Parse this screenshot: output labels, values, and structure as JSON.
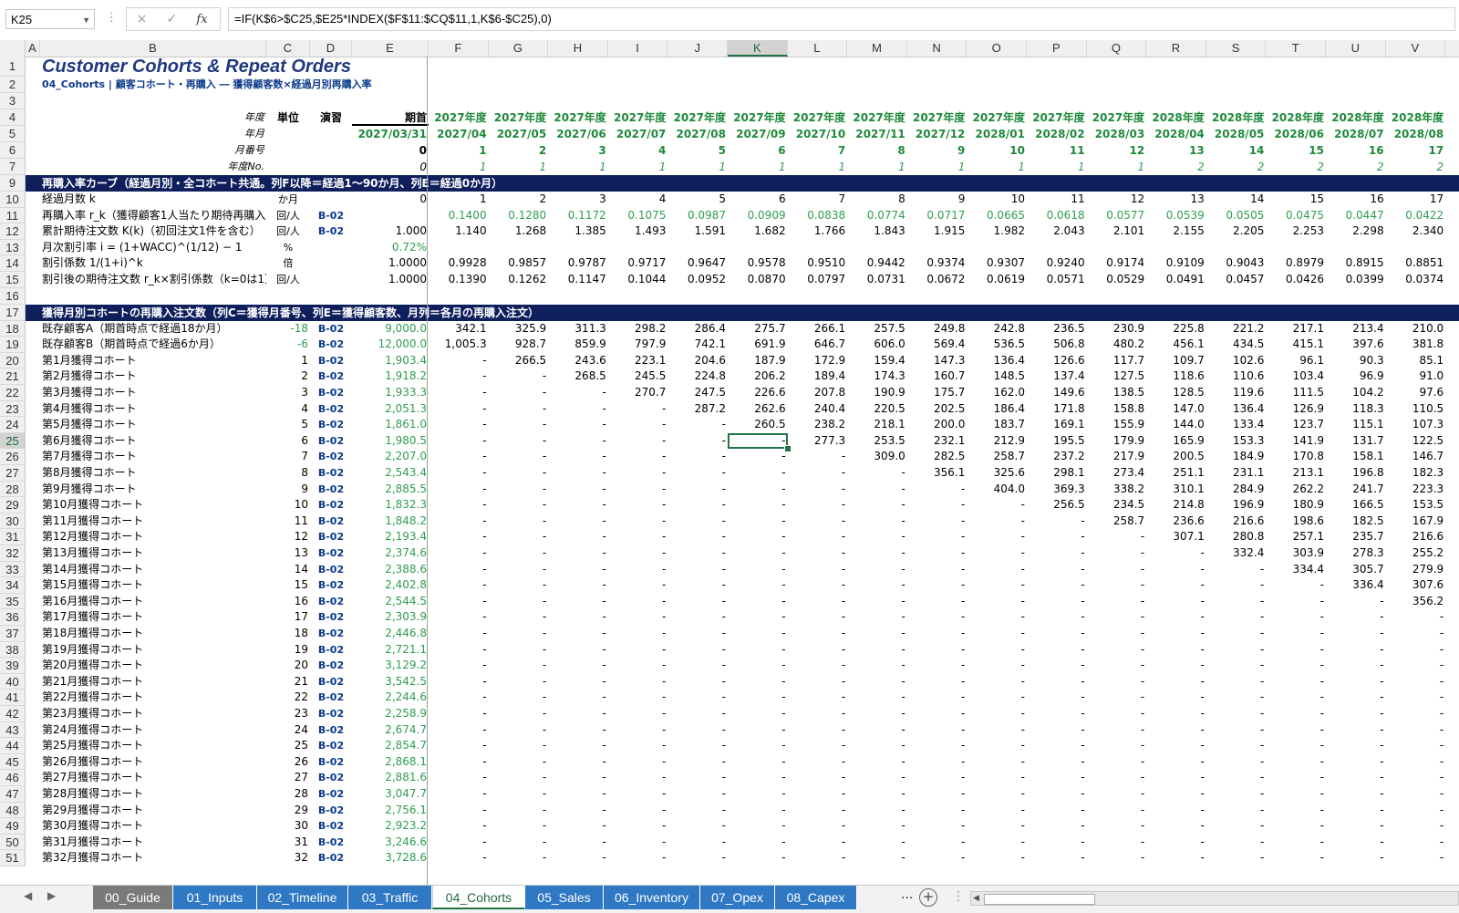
{
  "namebox": "K25",
  "formula": "=IF(K$6>$C25,$E25*INDEX($F$11:$CQ$11,1,K$6-$C25),0)",
  "formula_icons": {
    "cancel": "×",
    "enter": "✓",
    "fx": "fx"
  },
  "columns": [
    "A",
    "B",
    "C",
    "D",
    "E",
    "F",
    "G",
    "H",
    "I",
    "J",
    "K",
    "L",
    "M",
    "N",
    "O",
    "P",
    "Q",
    "R",
    "S",
    "T",
    "U",
    "V"
  ],
  "selected_column": "K",
  "selected_row": "25",
  "rows_numbers": [
    "1",
    "2",
    "3",
    "4",
    "5",
    "6",
    "7",
    "9",
    "10",
    "11",
    "12",
    "13",
    "14",
    "15",
    "16",
    "17",
    "18",
    "19",
    "20",
    "21",
    "22",
    "23",
    "24",
    "25",
    "26",
    "27",
    "28",
    "29",
    "30",
    "31",
    "32",
    "33",
    "34",
    "35",
    "36",
    "37",
    "38",
    "39",
    "40",
    "41",
    "42",
    "43",
    "44",
    "45",
    "46",
    "47",
    "48",
    "49",
    "50",
    "51"
  ],
  "title": "Customer Cohorts & Repeat Orders",
  "subtitle": "04_Cohorts | 顧客コホート・再購入 ― 獲得顧客数×経過月別再購入率",
  "header": {
    "row4": {
      "label": "年度",
      "unit": "単位",
      "ref": "演習",
      "e": "期首",
      "vals": [
        "2027年度",
        "2027年度",
        "2027年度",
        "2027年度",
        "2027年度",
        "2027年度",
        "2027年度",
        "2027年度",
        "2027年度",
        "2027年度",
        "2027年度",
        "2027年度",
        "2028年度",
        "2028年度",
        "2028年度",
        "2028年度",
        "2028年度"
      ]
    },
    "row5": {
      "label": "年月",
      "e": "2027/03/31",
      "vals": [
        "2027/04",
        "2027/05",
        "2027/06",
        "2027/07",
        "2027/08",
        "2027/09",
        "2027/10",
        "2027/11",
        "2027/12",
        "2028/01",
        "2028/02",
        "2028/03",
        "2028/04",
        "2028/05",
        "2028/06",
        "2028/07",
        "2028/08"
      ]
    },
    "row6": {
      "label": "月番号",
      "e": "0",
      "vals": [
        "1",
        "2",
        "3",
        "4",
        "5",
        "6",
        "7",
        "8",
        "9",
        "10",
        "11",
        "12",
        "13",
        "14",
        "15",
        "16",
        "17"
      ]
    },
    "row7": {
      "label": "年度No.",
      "e": "0",
      "vals": [
        "1",
        "1",
        "1",
        "1",
        "1",
        "1",
        "1",
        "1",
        "1",
        "1",
        "1",
        "1",
        "2",
        "2",
        "2",
        "2",
        "2"
      ]
    }
  },
  "section1": "再購入率カーブ（経過月別・全コホート共通。列F以降＝経過1～90か月、列E＝経過0か月）",
  "curve": [
    {
      "label": "経過月数 k",
      "unit": "か月",
      "ref": "",
      "e": "0",
      "cls": "",
      "vals": [
        "1",
        "2",
        "3",
        "4",
        "5",
        "6",
        "7",
        "8",
        "9",
        "10",
        "11",
        "12",
        "13",
        "14",
        "15",
        "16",
        "17"
      ]
    },
    {
      "label": "再購入率 r_k（獲得顧客1人当たり期待再購入注文数）",
      "unit": "回/人",
      "ref": "B-02",
      "e": "",
      "cls": "green",
      "vals": [
        "0.1400",
        "0.1280",
        "0.1172",
        "0.1075",
        "0.0987",
        "0.0909",
        "0.0838",
        "0.0774",
        "0.0717",
        "0.0665",
        "0.0618",
        "0.0577",
        "0.0539",
        "0.0505",
        "0.0475",
        "0.0447",
        "0.0422"
      ]
    },
    {
      "label": "累計期待注文数 K(k)（初回注文1件を含む）",
      "unit": "回/人",
      "ref": "B-02",
      "e": "1.000",
      "cls": "",
      "vals": [
        "1.140",
        "1.268",
        "1.385",
        "1.493",
        "1.591",
        "1.682",
        "1.766",
        "1.843",
        "1.915",
        "1.982",
        "2.043",
        "2.101",
        "2.155",
        "2.205",
        "2.253",
        "2.298",
        "2.340"
      ]
    },
    {
      "label": "月次割引率 i = (1+WACC)^(1/12) − 1",
      "unit": "%",
      "ref": "",
      "e": "0.72%",
      "cls": "green-e",
      "vals": []
    },
    {
      "label": "割引係数 1/(1+i)^k",
      "unit": "倍",
      "ref": "",
      "e": "1.0000",
      "cls": "",
      "vals": [
        "0.9928",
        "0.9857",
        "0.9787",
        "0.9717",
        "0.9647",
        "0.9578",
        "0.9510",
        "0.9442",
        "0.9374",
        "0.9307",
        "0.9240",
        "0.9174",
        "0.9109",
        "0.9043",
        "0.8979",
        "0.8915",
        "0.8851"
      ]
    },
    {
      "label": "割引後の期待注文数 r_k×割引係数（k=0は1）",
      "unit": "回/人",
      "ref": "",
      "e": "1.0000",
      "cls": "",
      "vals": [
        "0.1390",
        "0.1262",
        "0.1147",
        "0.1044",
        "0.0952",
        "0.0870",
        "0.0797",
        "0.0731",
        "0.0672",
        "0.0619",
        "0.0571",
        "0.0529",
        "0.0491",
        "0.0457",
        "0.0426",
        "0.0399",
        "0.0374"
      ]
    }
  ],
  "section2": "獲得月別コホートの再購入注文数（列C＝獲得月番号、列E＝獲得顧客数、月列＝各月の再購入注文）",
  "cohorts": [
    {
      "label": "既存顧客A（期首時点で経過18か月）",
      "c": "-18",
      "ref": "B-02",
      "e": "9,000.0",
      "vals": [
        "342.1",
        "325.9",
        "311.3",
        "298.2",
        "286.4",
        "275.7",
        "266.1",
        "257.5",
        "249.8",
        "242.8",
        "236.5",
        "230.9",
        "225.8",
        "221.2",
        "217.1",
        "213.4",
        "210.0"
      ]
    },
    {
      "label": "既存顧客B（期首時点で経過6か月）",
      "c": "-6",
      "ref": "B-02",
      "e": "12,000.0",
      "vals": [
        "1,005.3",
        "928.7",
        "859.9",
        "797.9",
        "742.1",
        "691.9",
        "646.7",
        "606.0",
        "569.4",
        "536.5",
        "506.8",
        "480.2",
        "456.1",
        "434.5",
        "415.1",
        "397.6",
        "381.8"
      ]
    },
    {
      "label": "第1月獲得コホート",
      "c": "1",
      "ref": "B-02",
      "e": "1,903.4",
      "vals": [
        "-",
        "266.5",
        "243.6",
        "223.1",
        "204.6",
        "187.9",
        "172.9",
        "159.4",
        "147.3",
        "136.4",
        "126.6",
        "117.7",
        "109.7",
        "102.6",
        "96.1",
        "90.3",
        "85.1"
      ]
    },
    {
      "label": "第2月獲得コホート",
      "c": "2",
      "ref": "B-02",
      "e": "1,918.2",
      "vals": [
        "-",
        "-",
        "268.5",
        "245.5",
        "224.8",
        "206.2",
        "189.4",
        "174.3",
        "160.7",
        "148.5",
        "137.4",
        "127.5",
        "118.6",
        "110.6",
        "103.4",
        "96.9",
        "91.0"
      ]
    },
    {
      "label": "第3月獲得コホート",
      "c": "3",
      "ref": "B-02",
      "e": "1,933.3",
      "vals": [
        "-",
        "-",
        "-",
        "270.7",
        "247.5",
        "226.6",
        "207.8",
        "190.9",
        "175.7",
        "162.0",
        "149.6",
        "138.5",
        "128.5",
        "119.6",
        "111.5",
        "104.2",
        "97.6"
      ]
    },
    {
      "label": "第4月獲得コホート",
      "c": "4",
      "ref": "B-02",
      "e": "2,051.3",
      "vals": [
        "-",
        "-",
        "-",
        "-",
        "287.2",
        "262.6",
        "240.4",
        "220.5",
        "202.5",
        "186.4",
        "171.8",
        "158.8",
        "147.0",
        "136.4",
        "126.9",
        "118.3",
        "110.5"
      ]
    },
    {
      "label": "第5月獲得コホート",
      "c": "5",
      "ref": "B-02",
      "e": "1,861.0",
      "vals": [
        "-",
        "-",
        "-",
        "-",
        "-",
        "260.5",
        "238.2",
        "218.1",
        "200.0",
        "183.7",
        "169.1",
        "155.9",
        "144.0",
        "133.4",
        "123.7",
        "115.1",
        "107.3"
      ]
    },
    {
      "label": "第6月獲得コホート",
      "c": "6",
      "ref": "B-02",
      "e": "1,980.5",
      "vals": [
        "-",
        "-",
        "-",
        "-",
        "-",
        "-",
        "277.3",
        "253.5",
        "232.1",
        "212.9",
        "195.5",
        "179.9",
        "165.9",
        "153.3",
        "141.9",
        "131.7",
        "122.5"
      ]
    },
    {
      "label": "第7月獲得コホート",
      "c": "7",
      "ref": "B-02",
      "e": "2,207.0",
      "vals": [
        "-",
        "-",
        "-",
        "-",
        "-",
        "-",
        "-",
        "309.0",
        "282.5",
        "258.7",
        "237.2",
        "217.9",
        "200.5",
        "184.9",
        "170.8",
        "158.1",
        "146.7"
      ]
    },
    {
      "label": "第8月獲得コホート",
      "c": "8",
      "ref": "B-02",
      "e": "2,543.4",
      "vals": [
        "-",
        "-",
        "-",
        "-",
        "-",
        "-",
        "-",
        "-",
        "356.1",
        "325.6",
        "298.1",
        "273.4",
        "251.1",
        "231.1",
        "213.1",
        "196.8",
        "182.3"
      ]
    },
    {
      "label": "第9月獲得コホート",
      "c": "9",
      "ref": "B-02",
      "e": "2,885.5",
      "vals": [
        "-",
        "-",
        "-",
        "-",
        "-",
        "-",
        "-",
        "-",
        "-",
        "404.0",
        "369.3",
        "338.2",
        "310.1",
        "284.9",
        "262.2",
        "241.7",
        "223.3"
      ]
    },
    {
      "label": "第10月獲得コホート",
      "c": "10",
      "ref": "B-02",
      "e": "1,832.3",
      "vals": [
        "-",
        "-",
        "-",
        "-",
        "-",
        "-",
        "-",
        "-",
        "-",
        "-",
        "256.5",
        "234.5",
        "214.8",
        "196.9",
        "180.9",
        "166.5",
        "153.5"
      ]
    },
    {
      "label": "第11月獲得コホート",
      "c": "11",
      "ref": "B-02",
      "e": "1,848.2",
      "vals": [
        "-",
        "-",
        "-",
        "-",
        "-",
        "-",
        "-",
        "-",
        "-",
        "-",
        "-",
        "258.7",
        "236.6",
        "216.6",
        "198.6",
        "182.5",
        "167.9"
      ]
    },
    {
      "label": "第12月獲得コホート",
      "c": "12",
      "ref": "B-02",
      "e": "2,193.4",
      "vals": [
        "-",
        "-",
        "-",
        "-",
        "-",
        "-",
        "-",
        "-",
        "-",
        "-",
        "-",
        "-",
        "307.1",
        "280.8",
        "257.1",
        "235.7",
        "216.6"
      ]
    },
    {
      "label": "第13月獲得コホート",
      "c": "13",
      "ref": "B-02",
      "e": "2,374.6",
      "vals": [
        "-",
        "-",
        "-",
        "-",
        "-",
        "-",
        "-",
        "-",
        "-",
        "-",
        "-",
        "-",
        "-",
        "332.4",
        "303.9",
        "278.3",
        "255.2"
      ]
    },
    {
      "label": "第14月獲得コホート",
      "c": "14",
      "ref": "B-02",
      "e": "2,388.6",
      "vals": [
        "-",
        "-",
        "-",
        "-",
        "-",
        "-",
        "-",
        "-",
        "-",
        "-",
        "-",
        "-",
        "-",
        "-",
        "334.4",
        "305.7",
        "279.9"
      ]
    },
    {
      "label": "第15月獲得コホート",
      "c": "15",
      "ref": "B-02",
      "e": "2,402.8",
      "vals": [
        "-",
        "-",
        "-",
        "-",
        "-",
        "-",
        "-",
        "-",
        "-",
        "-",
        "-",
        "-",
        "-",
        "-",
        "-",
        "336.4",
        "307.6"
      ]
    },
    {
      "label": "第16月獲得コホート",
      "c": "16",
      "ref": "B-02",
      "e": "2,544.5",
      "vals": [
        "-",
        "-",
        "-",
        "-",
        "-",
        "-",
        "-",
        "-",
        "-",
        "-",
        "-",
        "-",
        "-",
        "-",
        "-",
        "-",
        "356.2"
      ]
    },
    {
      "label": "第17月獲得コホート",
      "c": "17",
      "ref": "B-02",
      "e": "2,303.9",
      "vals": []
    },
    {
      "label": "第18月獲得コホート",
      "c": "18",
      "ref": "B-02",
      "e": "2,446.8",
      "vals": []
    },
    {
      "label": "第19月獲得コホート",
      "c": "19",
      "ref": "B-02",
      "e": "2,721.1",
      "vals": []
    },
    {
      "label": "第20月獲得コホート",
      "c": "20",
      "ref": "B-02",
      "e": "3,129.2",
      "vals": []
    },
    {
      "label": "第21月獲得コホート",
      "c": "21",
      "ref": "B-02",
      "e": "3,542.5",
      "vals": []
    },
    {
      "label": "第22月獲得コホート",
      "c": "22",
      "ref": "B-02",
      "e": "2,244.6",
      "vals": []
    },
    {
      "label": "第23月獲得コホート",
      "c": "23",
      "ref": "B-02",
      "e": "2,258.9",
      "vals": []
    },
    {
      "label": "第24月獲得コホート",
      "c": "24",
      "ref": "B-02",
      "e": "2,674.7",
      "vals": []
    },
    {
      "label": "第25月獲得コホート",
      "c": "25",
      "ref": "B-02",
      "e": "2,854.7",
      "vals": []
    },
    {
      "label": "第26月獲得コホート",
      "c": "26",
      "ref": "B-02",
      "e": "2,868.1",
      "vals": []
    },
    {
      "label": "第27月獲得コホート",
      "c": "27",
      "ref": "B-02",
      "e": "2,881.6",
      "vals": []
    },
    {
      "label": "第28月獲得コホート",
      "c": "28",
      "ref": "B-02",
      "e": "3,047.7",
      "vals": []
    },
    {
      "label": "第29月獲得コホート",
      "c": "29",
      "ref": "B-02",
      "e": "2,756.1",
      "vals": []
    },
    {
      "label": "第30月獲得コホート",
      "c": "30",
      "ref": "B-02",
      "e": "2,923.2",
      "vals": []
    },
    {
      "label": "第31月獲得コホート",
      "c": "31",
      "ref": "B-02",
      "e": "3,246.6",
      "vals": []
    },
    {
      "label": "第32月獲得コホート",
      "c": "32",
      "ref": "B-02",
      "e": "3,728.6",
      "vals": []
    }
  ],
  "tabs": [
    "00_Guide",
    "01_Inputs",
    "02_Timeline",
    "03_Traffic",
    "04_Cohorts",
    "05_Sales",
    "06_Inventory",
    "07_Opex",
    "08_Capex"
  ],
  "active_tab": "04_Cohorts",
  "tab_more": "...",
  "add_sheet": "+"
}
